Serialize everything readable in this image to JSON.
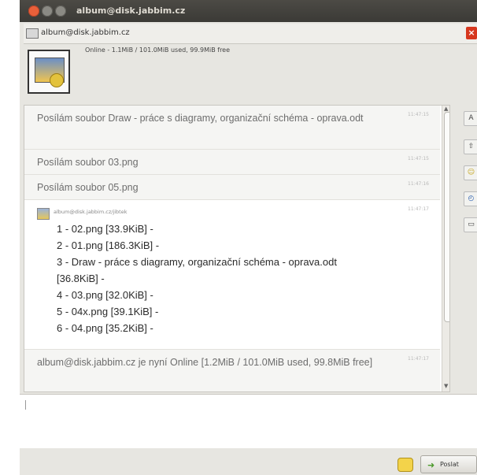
{
  "window": {
    "title": "album@disk.jabbim.cz"
  },
  "tab": {
    "label": "album@disk.jabbim.cz"
  },
  "contact": {
    "status": "Online - 1.1MiB / 101.0MiB used, 99.9MiB free"
  },
  "messages": [
    {
      "text": "Posílám soubor Draw - práce s diagramy, organizační schéma - oprava.odt",
      "time": "11:47:15"
    },
    {
      "text": "Posílám soubor 03.png",
      "time": "11:47:15"
    },
    {
      "text": "Posílám soubor 05.png",
      "time": "11:47:16"
    },
    {
      "sender": "album@disk.jabbim.cz/jibtek",
      "time": "11:47:17",
      "files": [
        "1 - 02.png [33.9KiB] -",
        "2 - 01.png [186.3KiB] -",
        "3 - Draw - práce s diagramy, organizační schéma - oprava.odt",
        "[36.8KiB] -",
        "4 - 03.png [32.0KiB] -",
        "5 - 04x.png [39.1KiB] -",
        "6 - 04.png [35.2KiB] -"
      ]
    },
    {
      "text": "album@disk.jabbim.cz je nyní Online [1.2MiB / 101.0MiB used, 99.8MiB free]",
      "time": "11:47:17"
    }
  ],
  "input": {
    "value": ""
  },
  "actions": {
    "send_label": "Poslat"
  }
}
